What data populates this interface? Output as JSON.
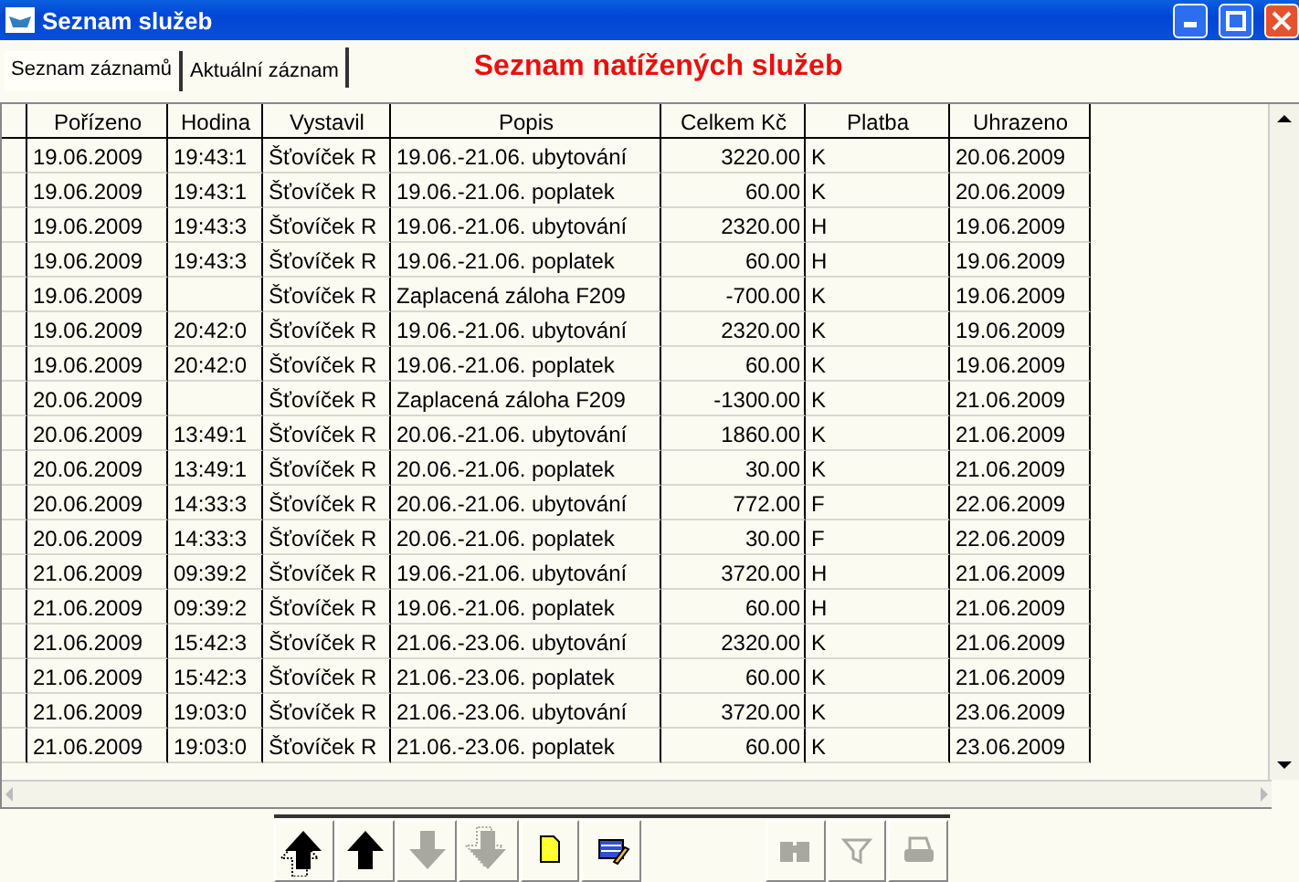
{
  "window": {
    "title": "Seznam služeb"
  },
  "tabs": [
    {
      "label": "Seznam záznamů",
      "selected": true
    },
    {
      "label": "Aktuální záznam",
      "selected": false
    }
  ],
  "heading": "Seznam natížených služeb",
  "table": {
    "columns": [
      "Pořízeno",
      "Hodina",
      "Vystavil",
      "Popis",
      "Celkem Kč",
      "Platba",
      "Uhrazeno"
    ],
    "rows": [
      [
        "19.06.2009",
        "19:43:1",
        "Šťovíček R",
        "19.06.-21.06. ubytování",
        "3220.00",
        "K",
        "20.06.2009"
      ],
      [
        "19.06.2009",
        "19:43:1",
        "Šťovíček R",
        "19.06.-21.06. poplatek",
        "60.00",
        "K",
        "20.06.2009"
      ],
      [
        "19.06.2009",
        "19:43:3",
        "Šťovíček R",
        "19.06.-21.06. ubytování",
        "2320.00",
        "H",
        "19.06.2009"
      ],
      [
        "19.06.2009",
        "19:43:3",
        "Šťovíček R",
        "19.06.-21.06. poplatek",
        "60.00",
        "H",
        "19.06.2009"
      ],
      [
        "19.06.2009",
        "",
        "Šťovíček R",
        "Zaplacená záloha F209",
        "-700.00",
        "K",
        "19.06.2009"
      ],
      [
        "19.06.2009",
        "20:42:0",
        "Šťovíček R",
        "19.06.-21.06. ubytování",
        "2320.00",
        "K",
        "19.06.2009"
      ],
      [
        "19.06.2009",
        "20:42:0",
        "Šťovíček R",
        "19.06.-21.06. poplatek",
        "60.00",
        "K",
        "19.06.2009"
      ],
      [
        "20.06.2009",
        "",
        "Šťovíček R",
        "Zaplacená záloha F209",
        "-1300.00",
        "K",
        "21.06.2009"
      ],
      [
        "20.06.2009",
        "13:49:1",
        "Šťovíček R",
        "20.06.-21.06. ubytování",
        "1860.00",
        "K",
        "21.06.2009"
      ],
      [
        "20.06.2009",
        "13:49:1",
        "Šťovíček R",
        "20.06.-21.06. poplatek",
        "30.00",
        "K",
        "21.06.2009"
      ],
      [
        "20.06.2009",
        "14:33:3",
        "Šťovíček R",
        "20.06.-21.06. ubytování",
        "772.00",
        "F",
        "22.06.2009"
      ],
      [
        "20.06.2009",
        "14:33:3",
        "Šťovíček R",
        "20.06.-21.06. poplatek",
        "30.00",
        "F",
        "22.06.2009"
      ],
      [
        "21.06.2009",
        "09:39:2",
        "Šťovíček R",
        "19.06.-21.06. ubytování",
        "3720.00",
        "H",
        "21.06.2009"
      ],
      [
        "21.06.2009",
        "09:39:2",
        "Šťovíček R",
        "19.06.-21.06. poplatek",
        "60.00",
        "H",
        "21.06.2009"
      ],
      [
        "21.06.2009",
        "15:42:3",
        "Šťovíček R",
        "21.06.-23.06. ubytování",
        "2320.00",
        "K",
        "21.06.2009"
      ],
      [
        "21.06.2009",
        "15:42:3",
        "Šťovíček R",
        "21.06.-23.06. poplatek",
        "60.00",
        "K",
        "21.06.2009"
      ],
      [
        "21.06.2009",
        "19:03:0",
        "Šťovíček R",
        "21.06.-23.06. ubytování",
        "3720.00",
        "K",
        "23.06.2009"
      ],
      [
        "21.06.2009",
        "19:03:0",
        "Šťovíček R",
        "21.06.-23.06. poplatek",
        "60.00",
        "K",
        "23.06.2009"
      ]
    ]
  },
  "toolbar": [
    {
      "kind": "first",
      "disabled": false
    },
    {
      "kind": "prev",
      "disabled": false
    },
    {
      "kind": "next",
      "disabled": true
    },
    {
      "kind": "last",
      "disabled": true
    },
    {
      "kind": "new",
      "disabled": false
    },
    {
      "kind": "edit",
      "disabled": false
    },
    {
      "kind": "find",
      "disabled": true
    },
    {
      "kind": "filter",
      "disabled": true
    },
    {
      "kind": "print",
      "disabled": true
    }
  ]
}
